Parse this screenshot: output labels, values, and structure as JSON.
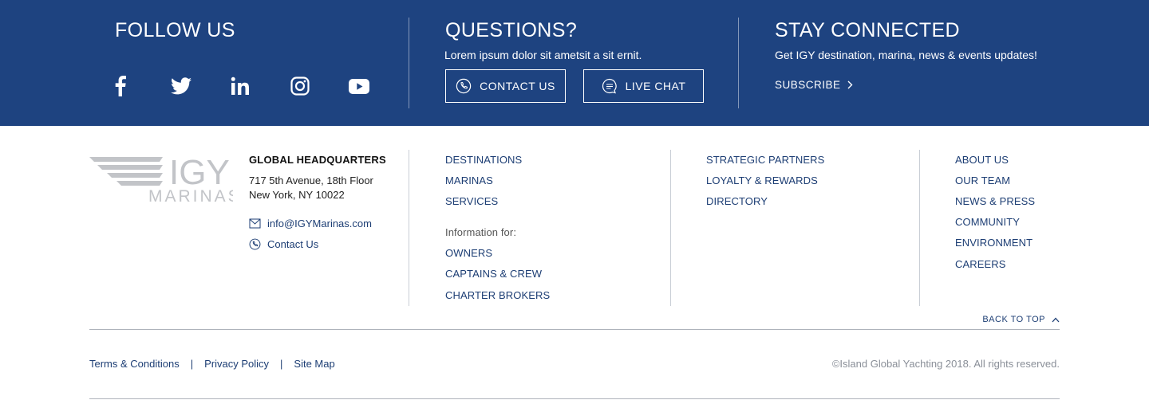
{
  "colors": {
    "band": "#1e4380",
    "link": "#1d3e74",
    "divider": "#c9ced6"
  },
  "follow": {
    "title": "FOLLOW US",
    "icons": [
      "facebook-icon",
      "twitter-icon",
      "linkedin-icon",
      "instagram-icon",
      "youtube-icon"
    ]
  },
  "questions": {
    "title": "QUESTIONS?",
    "text": "Lorem ipsum dolor sit ametsit a sit ernit.",
    "contact_label": "CONTACT US",
    "chat_label": "LIVE CHAT"
  },
  "stay": {
    "title": "STAY CONNECTED",
    "text": "Get IGY destination, marina, news & events updates!",
    "subscribe_label": "SUBSCRIBE"
  },
  "logo": {
    "brand": "IGY",
    "sub": "MARINAS"
  },
  "hq": {
    "title": "GLOBAL HEADQUARTERS",
    "line1": "717 5th Avenue, 18th Floor",
    "line2": "New York, NY 10022",
    "email": "info@IGYMarinas.com",
    "contact": "Contact Us"
  },
  "nav1": {
    "links": [
      "DESTINATIONS",
      "MARINAS",
      "SERVICES"
    ],
    "info_label": "Information for:",
    "info_links": [
      "OWNERS",
      "CAPTAINS & CREW",
      "CHARTER BROKERS"
    ]
  },
  "nav2": {
    "links": [
      "STRATEGIC PARTNERS",
      "LOYALTY & REWARDS",
      "DIRECTORY"
    ]
  },
  "nav3": {
    "links": [
      "ABOUT US",
      "OUR TEAM",
      "NEWS & PRESS",
      "COMMUNITY",
      "ENVIRONMENT",
      "CAREERS"
    ]
  },
  "back_to_top": "BACK TO TOP",
  "legal": {
    "terms": "Terms & Conditions",
    "privacy": "Privacy Policy",
    "sitemap": "Site Map",
    "sep": "|"
  },
  "copyright": "©Island Global Yachting 2018. All rights reserved."
}
